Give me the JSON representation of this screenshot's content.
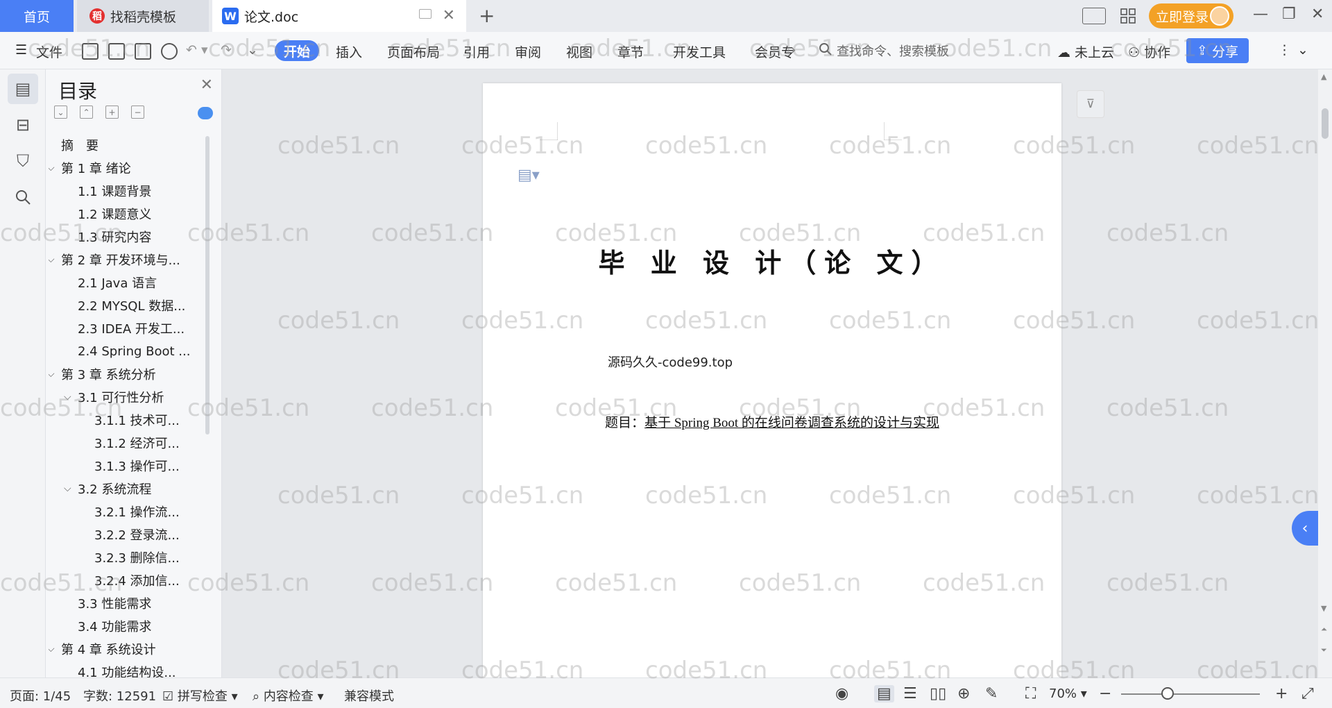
{
  "tabs": {
    "home": "首页",
    "doke": "找稻壳模板",
    "doc": "论文.doc",
    "login": "立即登录"
  },
  "ribbon": {
    "file": "文件",
    "items": [
      "开始",
      "插入",
      "页面布局",
      "引用",
      "审阅",
      "视图",
      "章节",
      "开发工具",
      "会员专"
    ],
    "search_placeholder": "查找命令、搜索模板",
    "cloud": "未上云",
    "collab": "协作",
    "share": "分享"
  },
  "toc": {
    "title": "目录",
    "items": [
      {
        "label": "摘　要",
        "level": 0,
        "caret": ""
      },
      {
        "label": "第 1 章  绪论",
        "level": 0,
        "caret": "v"
      },
      {
        "label": "1.1  课题背景",
        "level": 1,
        "caret": ""
      },
      {
        "label": "1.2  课题意义",
        "level": 1,
        "caret": ""
      },
      {
        "label": "1.3  研究内容",
        "level": 1,
        "caret": ""
      },
      {
        "label": "第 2 章  开发环境与...",
        "level": 0,
        "caret": "v"
      },
      {
        "label": "2.1 Java 语言",
        "level": 1,
        "caret": ""
      },
      {
        "label": "2.2 MYSQL 数据...",
        "level": 1,
        "caret": ""
      },
      {
        "label": "2.3 IDEA 开发工...",
        "level": 1,
        "caret": ""
      },
      {
        "label": "2.4 Spring Boot ...",
        "level": 1,
        "caret": ""
      },
      {
        "label": "第 3 章  系统分析",
        "level": 0,
        "caret": "v"
      },
      {
        "label": "3.1  可行性分析",
        "level": 1,
        "caret": "v"
      },
      {
        "label": "3.1.1  技术可...",
        "level": 2,
        "caret": ""
      },
      {
        "label": "3.1.2  经济可...",
        "level": 2,
        "caret": ""
      },
      {
        "label": "3.1.3  操作可...",
        "level": 2,
        "caret": ""
      },
      {
        "label": "3.2  系统流程",
        "level": 1,
        "caret": "v"
      },
      {
        "label": "3.2.1  操作流...",
        "level": 2,
        "caret": ""
      },
      {
        "label": "3.2.2  登录流...",
        "level": 2,
        "caret": ""
      },
      {
        "label": "3.2.3  删除信...",
        "level": 2,
        "caret": ""
      },
      {
        "label": "3.2.4  添加信...",
        "level": 2,
        "caret": ""
      },
      {
        "label": "3.3  性能需求",
        "level": 1,
        "caret": ""
      },
      {
        "label": "3.4  功能需求",
        "level": 1,
        "caret": ""
      },
      {
        "label": "第 4 章  系统设计",
        "level": 0,
        "caret": "v"
      },
      {
        "label": "4.1  功能结构设...",
        "level": 1,
        "caret": ""
      }
    ]
  },
  "document": {
    "title": "毕 业 设 计（论 文）",
    "source": "源码久久-code99.top",
    "topic_prefix": "题目：",
    "topic": "基于 Spring Boot 的在线问卷调查系统的设计与实现"
  },
  "status": {
    "page": "页面: 1/45",
    "words": "字数: 12591",
    "spell": "拼写检查",
    "content": "内容检查",
    "compat": "兼容模式",
    "zoom": "70%"
  },
  "watermark": "code51.cn",
  "colors": {
    "accent": "#4a7ff5",
    "login": "#f3a126"
  }
}
